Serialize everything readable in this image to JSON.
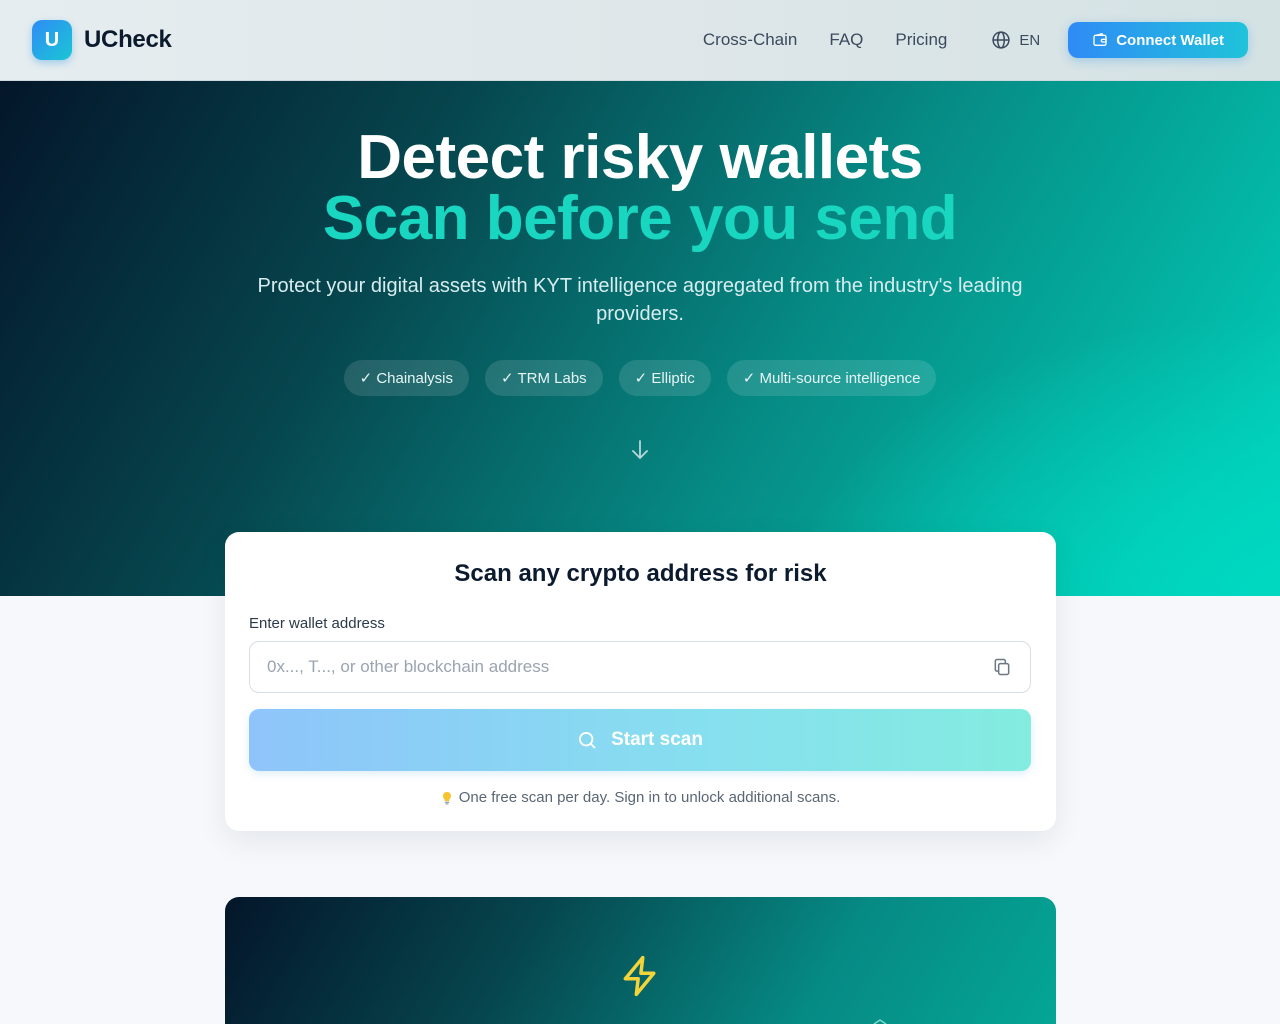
{
  "header": {
    "logo_letter": "U",
    "brand": "UCheck",
    "nav": [
      {
        "label": "Cross-Chain"
      },
      {
        "label": "FAQ"
      },
      {
        "label": "Pricing"
      }
    ],
    "lang": "EN",
    "connect_label": "Connect Wallet"
  },
  "hero": {
    "title_line1": "Detect risky wallets",
    "title_line2": "Scan before you send",
    "subtitle": "Protect your digital assets with KYT intelligence aggregated from the industry's leading providers.",
    "pills": [
      "✓ Chainalysis",
      "✓ TRM Labs",
      "✓ Elliptic",
      "✓ Multi-source intelligence"
    ]
  },
  "scan_card": {
    "title": "Scan any crypto address for risk",
    "field_label": "Enter wallet address",
    "input_value": "",
    "input_placeholder": "0x..., T..., or other blockchain address",
    "scan_label": "Start scan",
    "hint": "One free scan per day. Sign in to unlock additional scans."
  },
  "colors": {
    "accent_blue": "#2f8bf6",
    "accent_teal": "#19d6c0",
    "bolt_yellow": "#f2d43a"
  },
  "icons": [
    "globe-icon",
    "wallet-icon",
    "arrow-down-icon",
    "paste-icon",
    "search-icon",
    "bulb-icon",
    "bolt-icon"
  ]
}
